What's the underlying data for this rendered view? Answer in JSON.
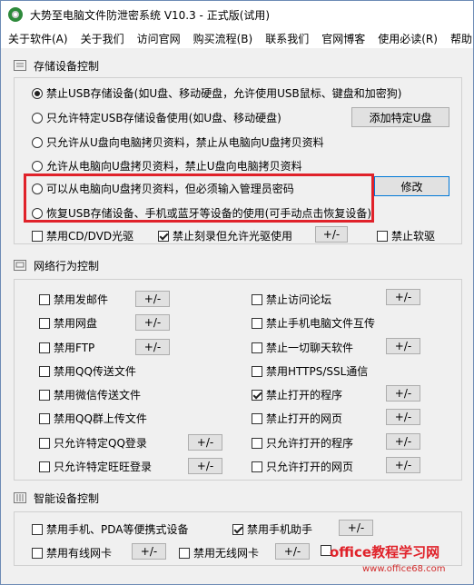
{
  "window": {
    "title": "大势至电脑文件防泄密系统 V10.3 - 正式版(试用)"
  },
  "menu": [
    "关于软件(A)",
    "关于我们",
    "访问官网",
    "购买流程(B)",
    "联系我们",
    "官网博客",
    "使用必读(R)",
    "帮助("
  ],
  "storage": {
    "heading": "存储设备控制",
    "options": [
      "禁止USB存储设备(如U盘、移动硬盘，允许使用USB鼠标、键盘和加密狗)",
      "只允许特定USB存储设备使用(如U盘、移动硬盘)",
      "只允许从U盘向电脑拷贝资料，禁止从电脑向U盘拷贝资料",
      "允许从电脑向U盘拷贝资料，禁止U盘向电脑拷贝资料",
      "可以从电脑向U盘拷贝资料，但必须输入管理员密码",
      "恢复USB存储设备、手机或蓝牙等设备的使用(可手动点击恢复设备)"
    ],
    "selected_index": 0,
    "add_device_button": "添加特定U盘",
    "modify_button": "修改",
    "cd_label": "禁用CD/DVD光驱",
    "cd_checked": false,
    "burn_label": "禁止刻录但允许光驱使用",
    "burn_checked": true,
    "burn_button": "+/-",
    "floppy_label": "禁止软驱",
    "floppy_checked": false
  },
  "network": {
    "heading": "网络行为控制",
    "left": [
      {
        "label": "禁用发邮件",
        "checked": false,
        "button": "+/-"
      },
      {
        "label": "禁用网盘",
        "checked": false,
        "button": "+/-"
      },
      {
        "label": "禁用FTP",
        "checked": false,
        "button": "+/-"
      },
      {
        "label": "禁用QQ传送文件",
        "checked": false,
        "button": ""
      },
      {
        "label": "禁用微信传送文件",
        "checked": false,
        "button": ""
      },
      {
        "label": "禁用QQ群上传文件",
        "checked": false,
        "button": ""
      },
      {
        "label": "只允许特定QQ登录",
        "checked": false,
        "button": "+/-"
      },
      {
        "label": "只允许特定旺旺登录",
        "checked": false,
        "button": "+/-"
      }
    ],
    "right": [
      {
        "label": "禁止访问论坛",
        "checked": false,
        "button": "+/-"
      },
      {
        "label": "禁止手机电脑文件互传",
        "checked": false,
        "button": ""
      },
      {
        "label": "禁止一切聊天软件",
        "checked": false,
        "button": "+/-"
      },
      {
        "label": "禁用HTTPS/SSL通信",
        "checked": false,
        "button": ""
      },
      {
        "label": "禁止打开的程序",
        "checked": true,
        "button": "+/-"
      },
      {
        "label": "禁止打开的网页",
        "checked": false,
        "button": "+/-"
      },
      {
        "label": "只允许打开的程序",
        "checked": false,
        "button": "+/-"
      },
      {
        "label": "只允许打开的网页",
        "checked": false,
        "button": "+/-"
      }
    ]
  },
  "smart": {
    "heading": "智能设备控制",
    "items": [
      {
        "label": "禁用手机、PDA等便携式设备",
        "checked": false
      },
      {
        "label": "禁用手机助手",
        "checked": true,
        "button": "+/-"
      },
      {
        "label": "禁用有线网卡",
        "checked": false,
        "button": "+/-"
      },
      {
        "label": "禁用无线网卡",
        "checked": false,
        "button": "+/-"
      }
    ]
  },
  "watermark": {
    "text": "office教程学习网",
    "url": "www.office68.com"
  },
  "colors": {
    "highlight_border": "#e0222a",
    "app_icon": "#2e8a3b"
  }
}
